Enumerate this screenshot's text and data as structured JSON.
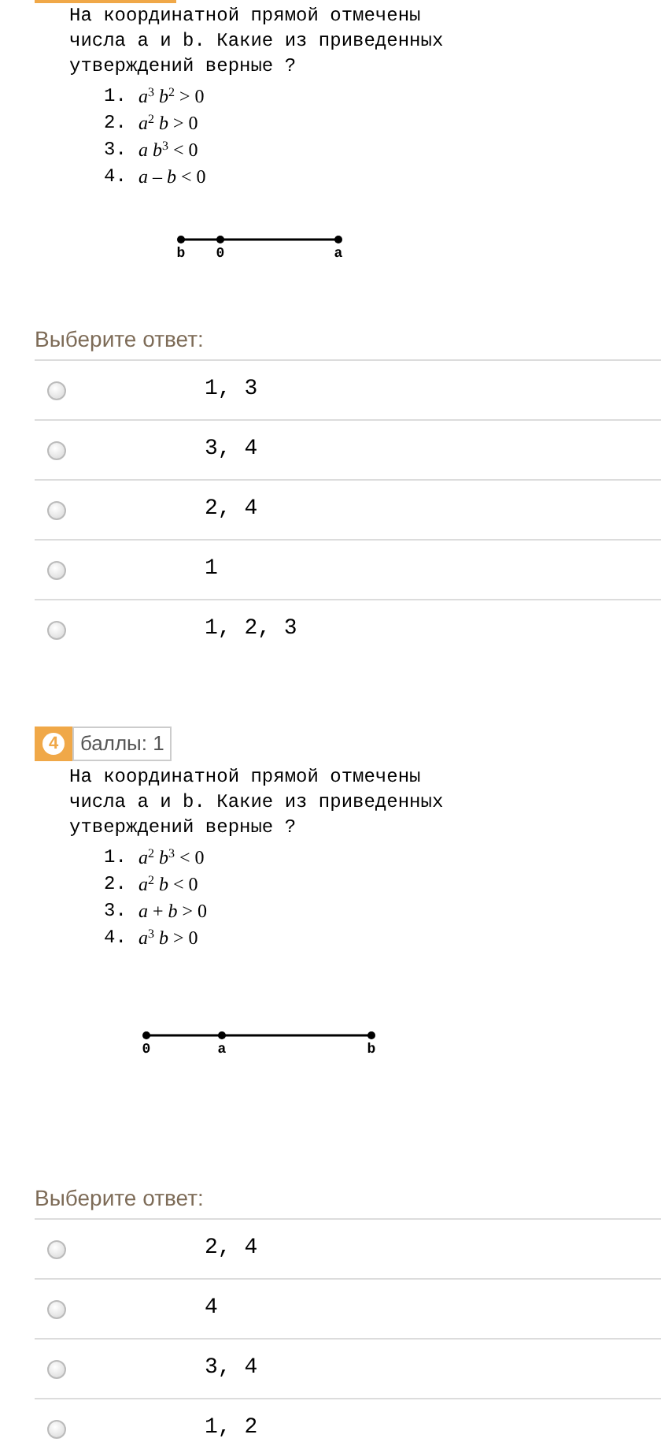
{
  "questions": [
    {
      "text_lines": [
        "На координатной прямой отмечены",
        "числа a и b. Какие из приведенных",
        "утверждений верные ?"
      ],
      "statements": [
        {
          "number": "1.",
          "formula": "*a*$^{3}$ *b*$^{2}$ > 0"
        },
        {
          "number": "2.",
          "formula": "*a*$^{2}$ *b* > 0"
        },
        {
          "number": "3.",
          "formula": "*a* *b*$^{3}$ < 0"
        },
        {
          "number": "4.",
          "formula": "*a* – *b* < 0"
        }
      ],
      "number_line": {
        "points": [
          {
            "label": "b"
          },
          {
            "label": "0"
          },
          {
            "label": "a"
          }
        ]
      },
      "answer_prompt": "Выберите ответ:",
      "options": [
        {
          "label": "1, 3",
          "selected": false
        },
        {
          "label": "3, 4",
          "selected": false
        },
        {
          "label": "2, 4",
          "selected": false
        },
        {
          "label": "1",
          "selected": false
        },
        {
          "label": "1, 2, 3",
          "selected": false
        }
      ]
    },
    {
      "badge": {
        "number": "4",
        "points": "баллы: 1"
      },
      "text_lines": [
        "На координатной прямой отмечены",
        "числа a и b. Какие из приведенных",
        "утверждений верные ?"
      ],
      "statements": [
        {
          "number": "1.",
          "formula": "*a*$^{2}$ *b*$^{3}$ < 0"
        },
        {
          "number": "2.",
          "formula": "*a*$^{2}$ *b* < 0"
        },
        {
          "number": "3.",
          "formula": "*a* + *b* > 0"
        },
        {
          "number": "4.",
          "formula": "*a*$^{3}$ *b* > 0"
        }
      ],
      "number_line": {
        "points": [
          {
            "label": "0"
          },
          {
            "label": "a"
          },
          {
            "label": "b"
          }
        ]
      },
      "answer_prompt": "Выберите ответ:",
      "options": [
        {
          "label": "2, 4",
          "selected": false
        },
        {
          "label": "4",
          "selected": false
        },
        {
          "label": "3, 4",
          "selected": false
        },
        {
          "label": "1, 2",
          "selected": false
        }
      ]
    }
  ]
}
